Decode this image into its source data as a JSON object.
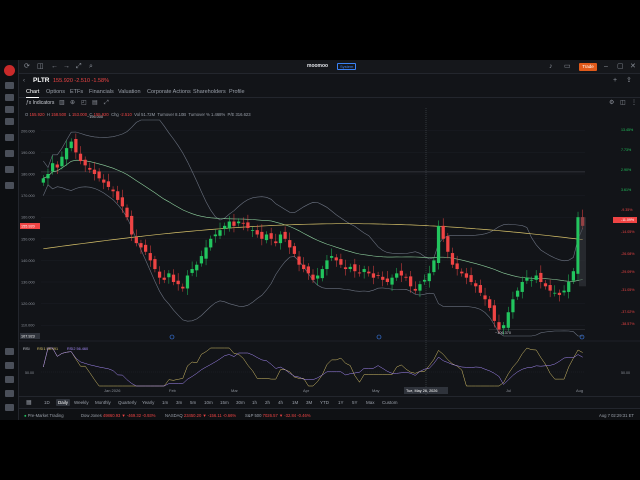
{
  "app": {
    "brand": "moomoo",
    "brand_badge": "System",
    "trade_label": "Trade"
  },
  "quote": {
    "symbol": "PLTR",
    "price_change": "155.920  -2.510  -1.58%"
  },
  "tabs": [
    "Chart",
    "Options",
    "ETFs",
    "Financials",
    "Valuation",
    "Corporate Actions",
    "Shareholders",
    "Profile"
  ],
  "toolbar": {
    "indicators_label": "Indicators"
  },
  "ohlc": {
    "o_label": "O",
    "o": "155.920",
    "h_label": "H",
    "h": "158.500",
    "l_label": "L",
    "l": "153.000",
    "c_label": "C",
    "c": "155.920",
    "chg_label": "Chg",
    "chg": "-2.510",
    "vol": "Vol 51.72M",
    "turnover": "Turnover 8.10B",
    "turnover_rate": "Turnover % 1.468%",
    "pe": "P/E 316.623"
  },
  "price_axis": [
    "200.000",
    "190.000",
    "180.000",
    "170.000",
    "160.000",
    "150.000",
    "140.000",
    "130.000",
    "120.000",
    "110.000"
  ],
  "price_tag_left": "155.920",
  "price_tag_bottom": "107.923",
  "pct_axis": [
    "13.45%",
    "7.73%",
    "2.90%",
    "3.61%",
    "-9.35%",
    "-11.09%",
    "-14.05%",
    "-26.08%",
    "-29.09%",
    "-31.05%",
    "-37.02%",
    "-38.57%"
  ],
  "annotations": {
    "high_label": "~195.000",
    "low_label": "~106.370"
  },
  "x_axis": [
    "Jan 2026",
    "Feb",
    "Mar",
    "Apr",
    "May",
    "Jul",
    "Aug"
  ],
  "crosshair_label": "Tue, May 26, 2026",
  "rsi": {
    "label": "RSI",
    "rsi1": "RSI1 58.491",
    "rsi2": "RSI2 56.460",
    "axis": [
      "50.00",
      "50.00"
    ]
  },
  "periods": [
    "1D",
    "Daily",
    "Weekly",
    "Monthly",
    "Quarterly",
    "Yearly",
    "1m",
    "3m",
    "5m",
    "10m",
    "15m",
    "30m",
    "1h",
    "2h",
    "4h",
    "1M",
    "3M",
    "YTD",
    "1Y",
    "5Y",
    "Max",
    "Custom"
  ],
  "status": {
    "market": "Pre-Market Trading",
    "dow_label": "Dow Jones",
    "dow": "49860.93 ▼ -469.32 -0.93%",
    "nasdaq_label": "NASDAQ",
    "nasdaq": "23450.20 ▼ -156.11 -0.66%",
    "sp_label": "S&P 500",
    "sp": "7026.57 ▼ -32.84 -0.46%",
    "time": "Aug 7 02:29:31 ET"
  },
  "colors": {
    "up": "#22c55e",
    "down": "#ef4444",
    "ma_long": "#d7c26a",
    "ma_mid": "#8fd19e",
    "bollinger": "#6b7280",
    "accent": "#e05a1a"
  },
  "chart_data": {
    "type": "candlestick",
    "ylim": [
      105,
      205
    ],
    "series": [
      {
        "name": "PLTR daily close",
        "values": [
          178,
          180,
          185,
          183,
          188,
          192,
          195,
          190,
          186,
          184,
          182,
          180,
          178,
          176,
          174,
          172,
          168,
          165,
          160,
          152,
          148,
          146,
          144,
          140,
          136,
          132,
          131,
          134,
          130,
          129,
          127,
          133,
          136,
          138,
          142,
          146,
          150,
          152,
          154,
          156,
          158,
          156,
          158,
          157,
          155,
          154,
          152,
          150,
          152,
          150,
          148,
          152,
          150,
          146,
          143,
          138,
          136,
          134,
          131,
          133,
          136,
          140,
          142,
          140,
          138,
          136,
          137,
          135,
          134,
          136,
          134,
          132,
          133,
          131,
          130,
          132,
          134,
          133,
          132,
          128,
          126,
          129,
          131,
          134,
          140,
          156,
          150,
          144,
          138,
          136,
          134,
          132,
          130,
          128,
          125,
          122,
          118,
          112,
          108,
          110,
          116,
          122,
          126,
          130,
          132,
          131,
          133,
          130,
          128,
          126,
          125,
          124,
          126,
          130,
          135,
          160,
          156
        ]
      }
    ]
  }
}
